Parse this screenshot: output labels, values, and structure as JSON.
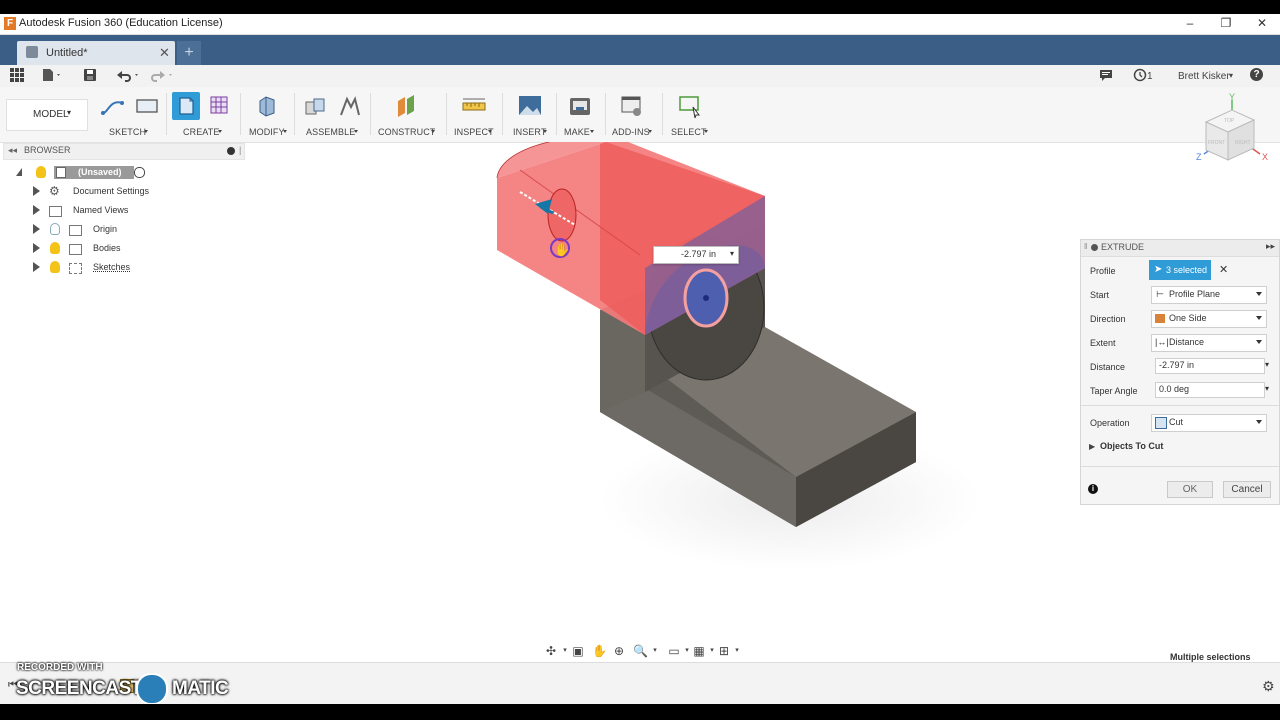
{
  "window": {
    "title": "Autodesk Fusion 360 (Education License)",
    "app_icon_letter": "F",
    "controls": [
      "–",
      "❐",
      "✕"
    ]
  },
  "tabs": {
    "doc_title": "Untitled*",
    "close": "✕",
    "new_tab": "+"
  },
  "quickbar": {
    "jobs_count": "1",
    "user": "Brett Kisker",
    "help": "?"
  },
  "ribbon": {
    "workspace": "MODEL",
    "groups": [
      "SKETCH",
      "CREATE",
      "MODIFY",
      "ASSEMBLE",
      "CONSTRUCT",
      "INSPECT",
      "INSERT",
      "MAKE",
      "ADD-INS",
      "SELECT"
    ]
  },
  "browser": {
    "title": "BROWSER",
    "root": "(Unsaved)",
    "items": [
      "Document Settings",
      "Named Views",
      "Origin",
      "Bodies",
      "Sketches"
    ]
  },
  "viewcube": {
    "axis_y": "Y",
    "axis_z": "Z",
    "axis_x": "X",
    "face_top": "TOP",
    "face_front": "FRONT",
    "face_right": "RIGHT"
  },
  "viewport": {
    "distance_callout": "-2.797 in"
  },
  "extrude": {
    "title": "EXTRUDE",
    "profile_label": "Profile",
    "profile_value": "3 selected",
    "start_label": "Start",
    "start_value": "Profile Plane",
    "direction_label": "Direction",
    "direction_value": "One Side",
    "extent_label": "Extent",
    "extent_value": "Distance",
    "distance_label": "Distance",
    "distance_value": "-2.797 in",
    "taper_label": "Taper Angle",
    "taper_value": "0.0 deg",
    "operation_label": "Operation",
    "operation_value": "Cut",
    "objects_to_cut": "Objects To Cut",
    "ok": "OK",
    "cancel": "Cancel"
  },
  "status": {
    "selection": "Multiple selections"
  },
  "watermark": {
    "line1": "RECORDED WITH",
    "line2a": "SCREENCAST",
    "line2b": "MATIC"
  },
  "colors": {
    "accent": "#2f9bd7",
    "tab_bar": "#3a5e86",
    "extrude_red": "#f26a6a",
    "profile_blue": "#4f5fb0",
    "body_gray": "#5e5a55"
  }
}
